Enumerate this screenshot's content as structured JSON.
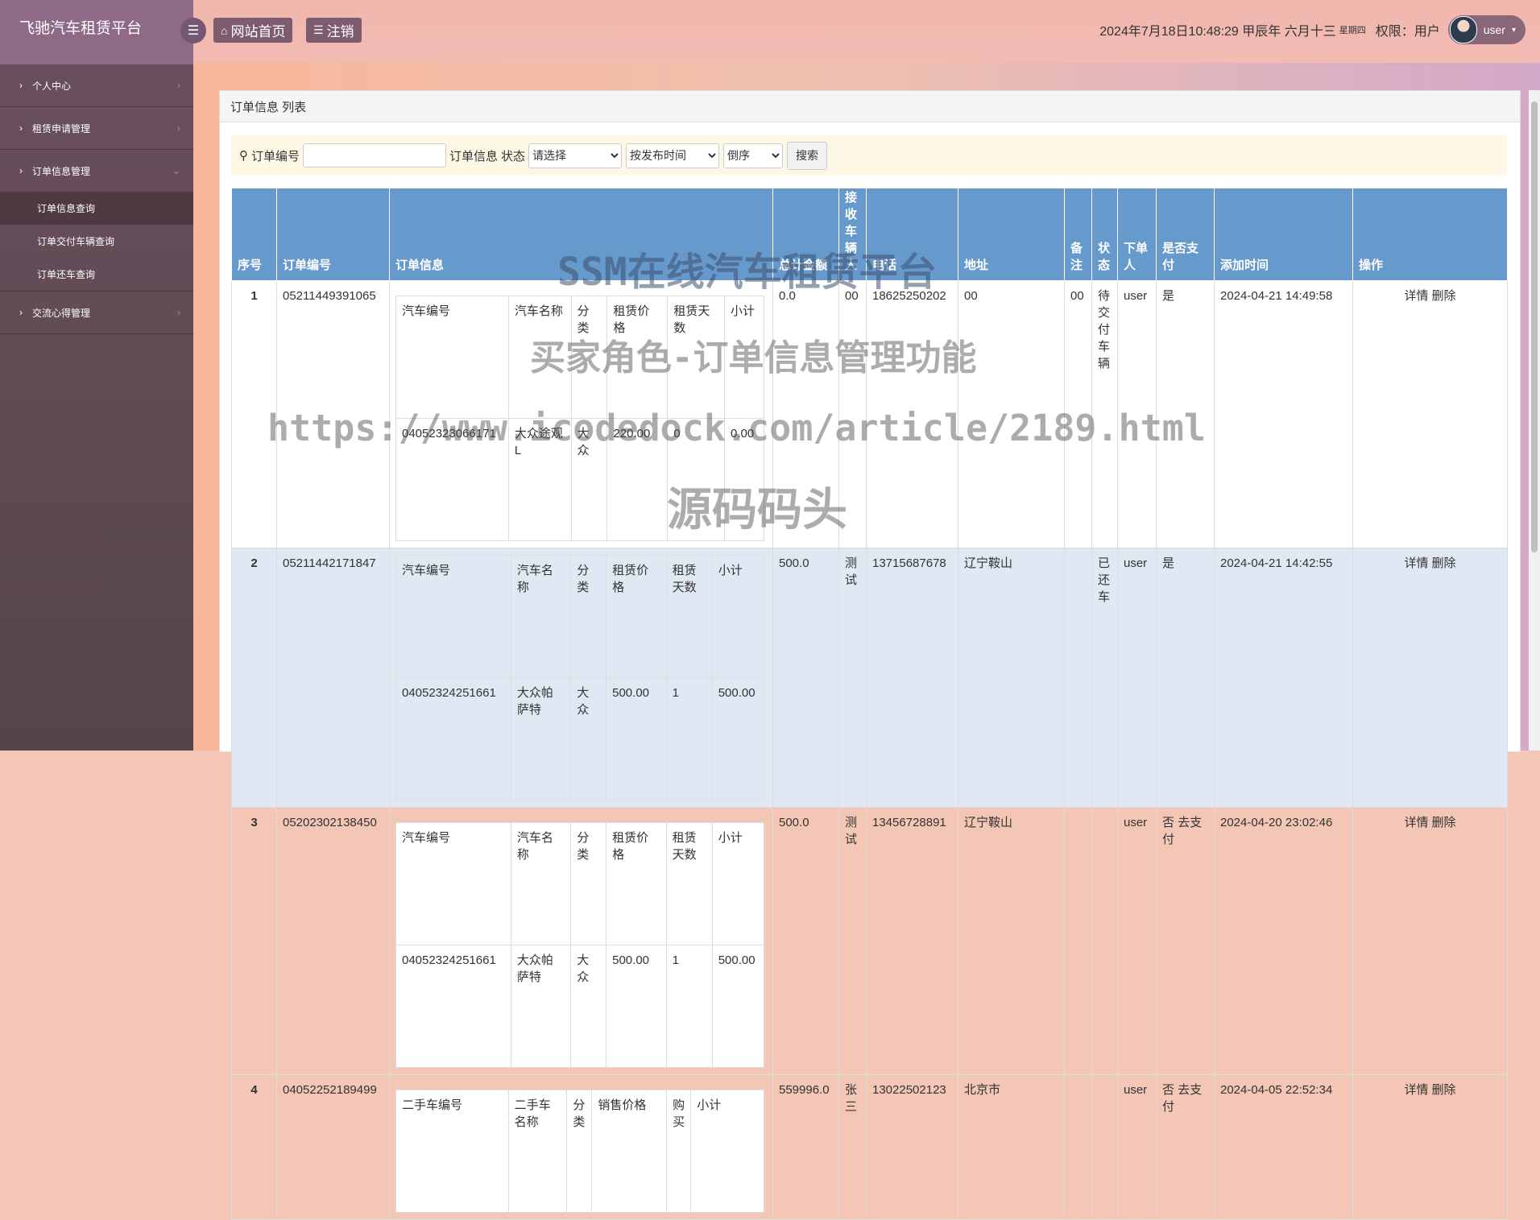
{
  "app": {
    "title": "飞驰汽车租赁平台",
    "menu_toggle_icon": "bars-icon"
  },
  "sidebar": {
    "items": [
      {
        "label": "个人中心",
        "expanded": false,
        "children": []
      },
      {
        "label": "租赁申请管理",
        "expanded": false,
        "children": []
      },
      {
        "label": "订单信息管理",
        "expanded": true,
        "children": [
          "订单信息查询",
          "订单交付车辆查询",
          "订单还车查询"
        ]
      },
      {
        "label": "交流心得管理",
        "expanded": false,
        "children": []
      }
    ],
    "active_child": "订单信息查询"
  },
  "topbar": {
    "home_label": "网站首页",
    "logout_label": "注销",
    "datetime": "2024年7月18日10:48:29 甲辰年 六月十三",
    "weekday": "星期四",
    "role": "权限：用户",
    "username": "user"
  },
  "panel": {
    "title": "订单信息 列表"
  },
  "search": {
    "order_no_label": "订单编号",
    "order_info_label": "订单信息",
    "status_label": "状态",
    "status_select": "请选择",
    "sort_select": "按发布时间",
    "order_select": "倒序",
    "button": "搜索"
  },
  "table": {
    "headers": [
      "序号",
      "订单编号",
      "订单信息",
      "总计金额",
      "接收车辆人",
      "电话",
      "地址",
      "备注",
      "状态",
      "下单人",
      "是否支付",
      "添加时间",
      "操作"
    ],
    "rows": [
      {
        "no": "1",
        "order_no": "05211449391065",
        "inner_headers": [
          "汽车编号",
          "汽车名称",
          "分类",
          "租赁价格",
          "租赁天数",
          "小计"
        ],
        "inner_values": [
          "04052323066171",
          "大众途观L",
          "大众",
          "220.00",
          "0",
          "0.00"
        ],
        "total": "0.0",
        "receiver": "00",
        "phone": "18625250202",
        "address": "00",
        "remark": "00",
        "status": "待交付车辆",
        "user": "user",
        "paid": "是",
        "pay_link": "",
        "time": "2024-04-21 14:49:58"
      },
      {
        "no": "2",
        "order_no": "05211442171847",
        "inner_headers": [
          "汽车编号",
          "汽车名称",
          "分类",
          "租赁价格",
          "租赁天数",
          "小计"
        ],
        "inner_values": [
          "04052324251661",
          "大众帕萨特",
          "大众",
          "500.00",
          "1",
          "500.00"
        ],
        "total": "500.0",
        "receiver": "测试",
        "phone": "13715687678",
        "address": "辽宁鞍山",
        "remark": "",
        "status": "已还车",
        "user": "user",
        "paid": "是",
        "pay_link": "",
        "time": "2024-04-21 14:42:55"
      },
      {
        "no": "3",
        "order_no": "05202302138450",
        "inner_headers": [
          "汽车编号",
          "汽车名称",
          "分类",
          "租赁价格",
          "租赁天数",
          "小计"
        ],
        "inner_values": [
          "04052324251661",
          "大众帕萨特",
          "大众",
          "500.00",
          "1",
          "500.00"
        ],
        "total": "500.0",
        "receiver": "测试",
        "phone": "13456728891",
        "address": "辽宁鞍山",
        "remark": "",
        "status": "",
        "user": "user",
        "paid": "否",
        "pay_link": "去支付",
        "time": "2024-04-20 23:02:46"
      },
      {
        "no": "4",
        "order_no": "04052252189499",
        "inner_headers": [
          "二手车编号",
          "二手车名称",
          "分类",
          "销售价格",
          "购买",
          "小计"
        ],
        "inner_values": [],
        "total": "559996.0",
        "receiver": "张三",
        "phone": "13022502123",
        "address": "北京市",
        "remark": "",
        "status": "",
        "user": "user",
        "paid": "否",
        "pay_link": "去支付",
        "time": "2024-04-05 22:52:34"
      }
    ],
    "actions": [
      "详情",
      "删除"
    ]
  },
  "watermarks": [
    "SSM在线汽车租赁平台",
    "买家角色-订单信息管理功能",
    "https://www.icodedock.com/article/2189.html",
    "源码码头"
  ]
}
